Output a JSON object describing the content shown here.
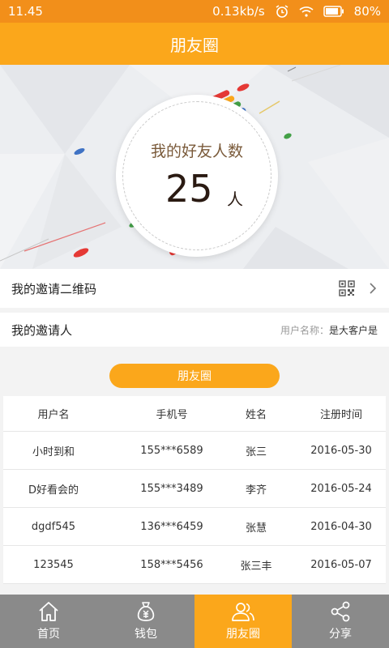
{
  "status_bar": {
    "time": "11.45",
    "network_speed": "0.13kb/s",
    "battery": "80%"
  },
  "header": {
    "title": "朋友圈"
  },
  "friends_card": {
    "title": "我的好友人数",
    "count": "25",
    "unit": "人"
  },
  "qr_row": {
    "label": "我的邀请二维码"
  },
  "inviter_row": {
    "label": "我的邀请人",
    "name_key": "用户名称：",
    "name_value": "是大客户是"
  },
  "section_pill": {
    "label": "朋友圈"
  },
  "table": {
    "headers": [
      "用户名",
      "手机号",
      "姓名",
      "注册时间"
    ],
    "rows": [
      [
        "小时到和",
        "155***6589",
        "张三",
        "2016-05-30"
      ],
      [
        "D好看会的",
        "155***3489",
        "李齐",
        "2016-05-24"
      ],
      [
        "dgdf545",
        "136***6459",
        "张慧",
        "2016-04-30"
      ],
      [
        "123545",
        "158***5456",
        "张三丰",
        "2016-05-07"
      ]
    ]
  },
  "tab_bar": {
    "items": [
      {
        "label": "首页",
        "icon": "home-icon"
      },
      {
        "label": "钱包",
        "icon": "wallet-icon"
      },
      {
        "label": "朋友圈",
        "icon": "friends-icon",
        "active": true
      },
      {
        "label": "分享",
        "icon": "share-icon"
      }
    ]
  },
  "colors": {
    "accent": "#fba71b",
    "status_bar": "#f28f1a",
    "tab_bar": "#8a8a8a"
  }
}
